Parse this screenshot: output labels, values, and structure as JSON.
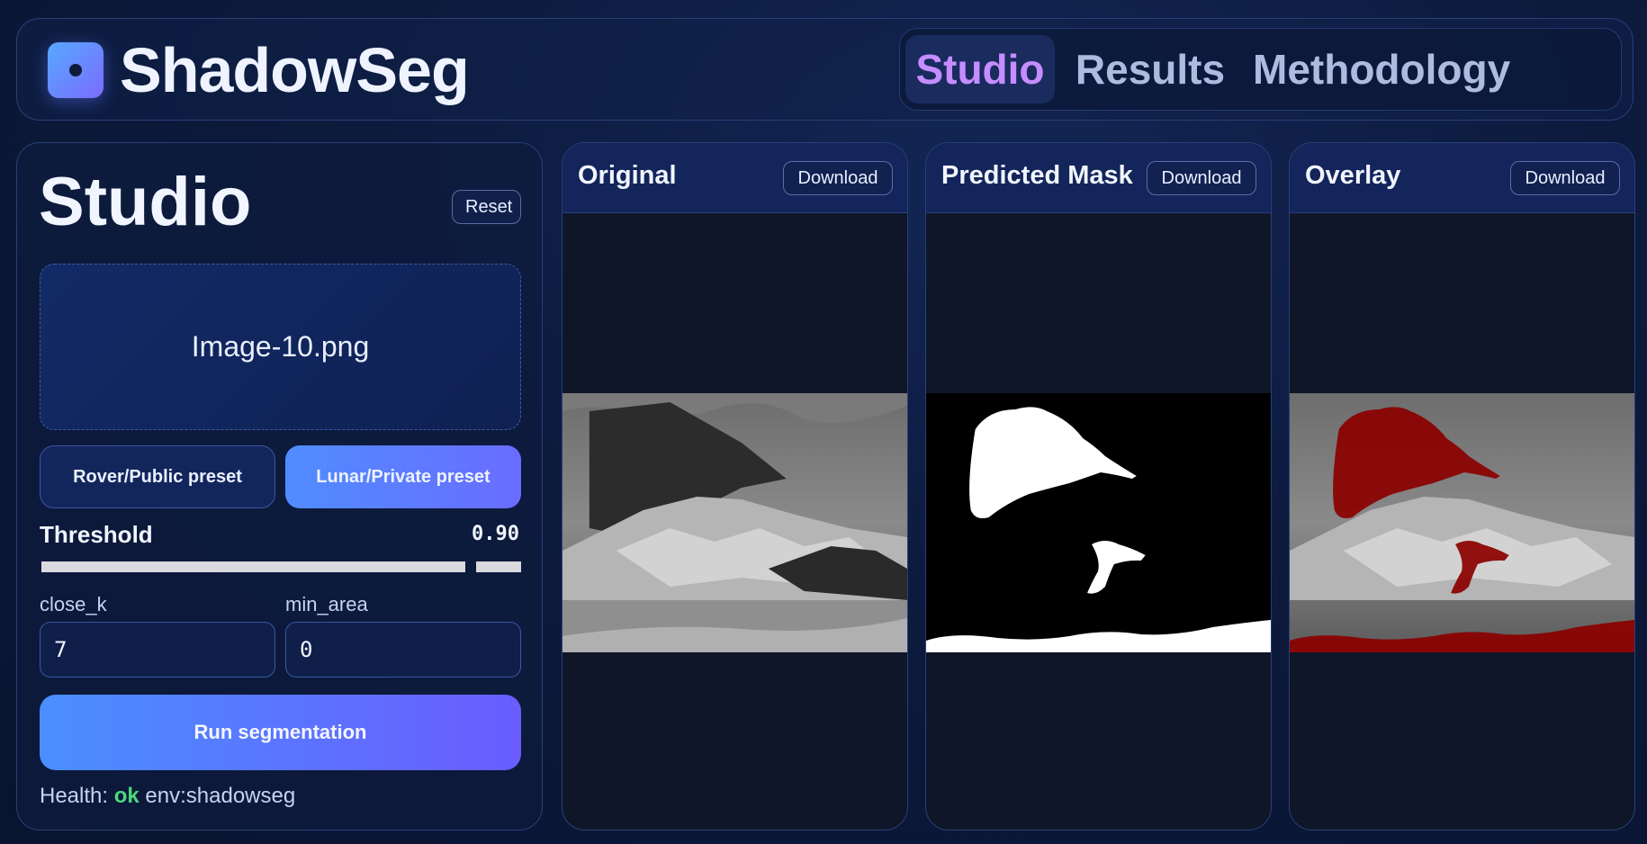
{
  "app": {
    "name": "ShadowSeg"
  },
  "nav": {
    "tabs": [
      "Studio",
      "Results",
      "Methodology"
    ],
    "active": "Studio"
  },
  "studio": {
    "title": "Studio",
    "reset_label": "Reset",
    "file_name": "Image-10.png",
    "presets": [
      "Rover/Public preset",
      "Lunar/Private preset"
    ],
    "threshold_label": "Threshold",
    "threshold_value": "0.90",
    "threshold_level": 0.9,
    "close_k_label": "close_k",
    "close_k_value": "7",
    "min_area_label": "min_area",
    "min_area_value": "0",
    "run_label": "Run segmentation",
    "health_prefix": "Health:",
    "health_status": "ok",
    "health_env": "env:shadowseg"
  },
  "panels": {
    "original": {
      "title": "Original",
      "download_label": "Download"
    },
    "mask": {
      "title": "Predicted Mask",
      "download_label": "Download"
    },
    "overlay": {
      "title": "Overlay",
      "download_label": "Download"
    }
  },
  "colors": {
    "accent": "#c58dff",
    "ok": "#4ed87c",
    "overlay": "#8b0000"
  }
}
